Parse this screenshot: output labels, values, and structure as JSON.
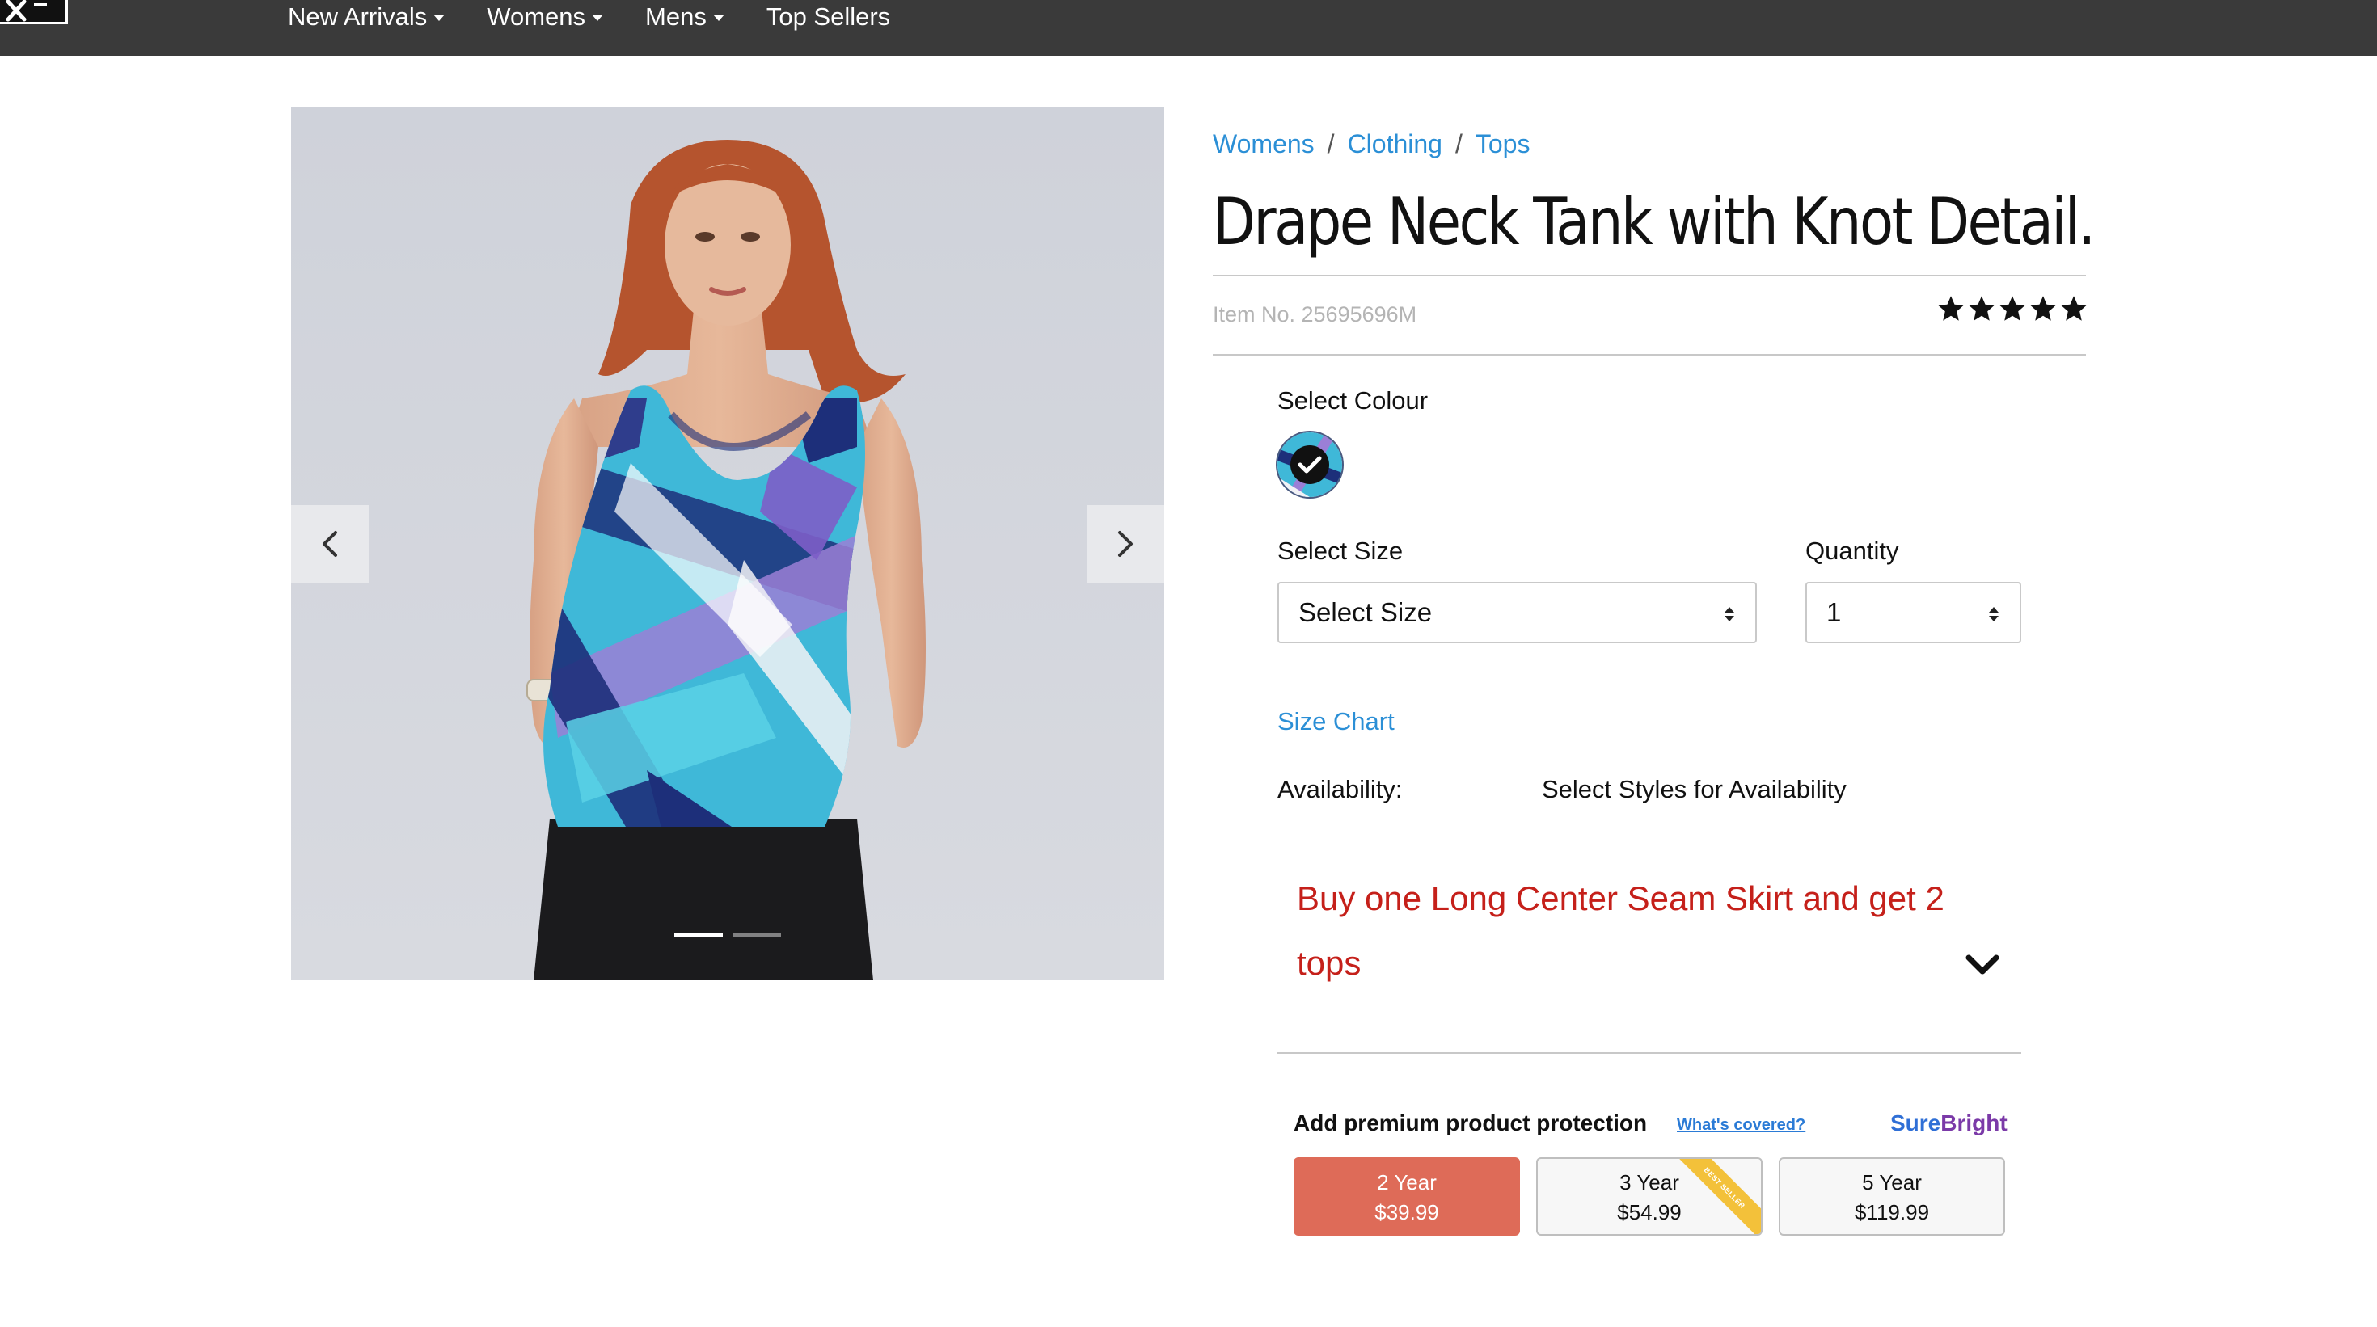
{
  "nav": {
    "items": [
      {
        "label": "New Arrivals",
        "dropdown": true
      },
      {
        "label": "Womens",
        "dropdown": true
      },
      {
        "label": "Mens",
        "dropdown": true
      },
      {
        "label": "Top Sellers",
        "dropdown": false
      }
    ]
  },
  "gallery": {
    "slide_count": 2,
    "active_slide": 1
  },
  "breadcrumb": {
    "items": [
      "Womens",
      "Clothing",
      "Tops"
    ],
    "separator": "/"
  },
  "product": {
    "title": "Drape Neck Tank with Knot Detail.",
    "item_no": "Item No. 25695696M",
    "rating": 5
  },
  "options": {
    "colour_label": "Select Colour",
    "size_label": "Select Size",
    "size_value": "Select Size",
    "quantity_label": "Quantity",
    "quantity_value": "1",
    "size_chart": "Size Chart",
    "availability_label": "Availability:",
    "availability_value": "Select Styles for Availability"
  },
  "promo": {
    "text": "Buy one Long Center Seam Skirt and get 2 tops",
    "color": "#c5201a"
  },
  "protection": {
    "title": "Add premium product protection",
    "link": "What's covered?",
    "brand_part1": "Sure",
    "brand_part2": "Bright",
    "plans": [
      {
        "term": "2 Year",
        "price": "$39.99",
        "selected": true
      },
      {
        "term": "3 Year",
        "price": "$54.99",
        "selected": false,
        "ribbon": "BEST SELLER"
      },
      {
        "term": "5 Year",
        "price": "$119.99",
        "selected": false
      }
    ],
    "selected_color": "#de6b58"
  },
  "colors": {
    "nav_bg": "#3a3a3a",
    "link": "#2b8fd6"
  }
}
